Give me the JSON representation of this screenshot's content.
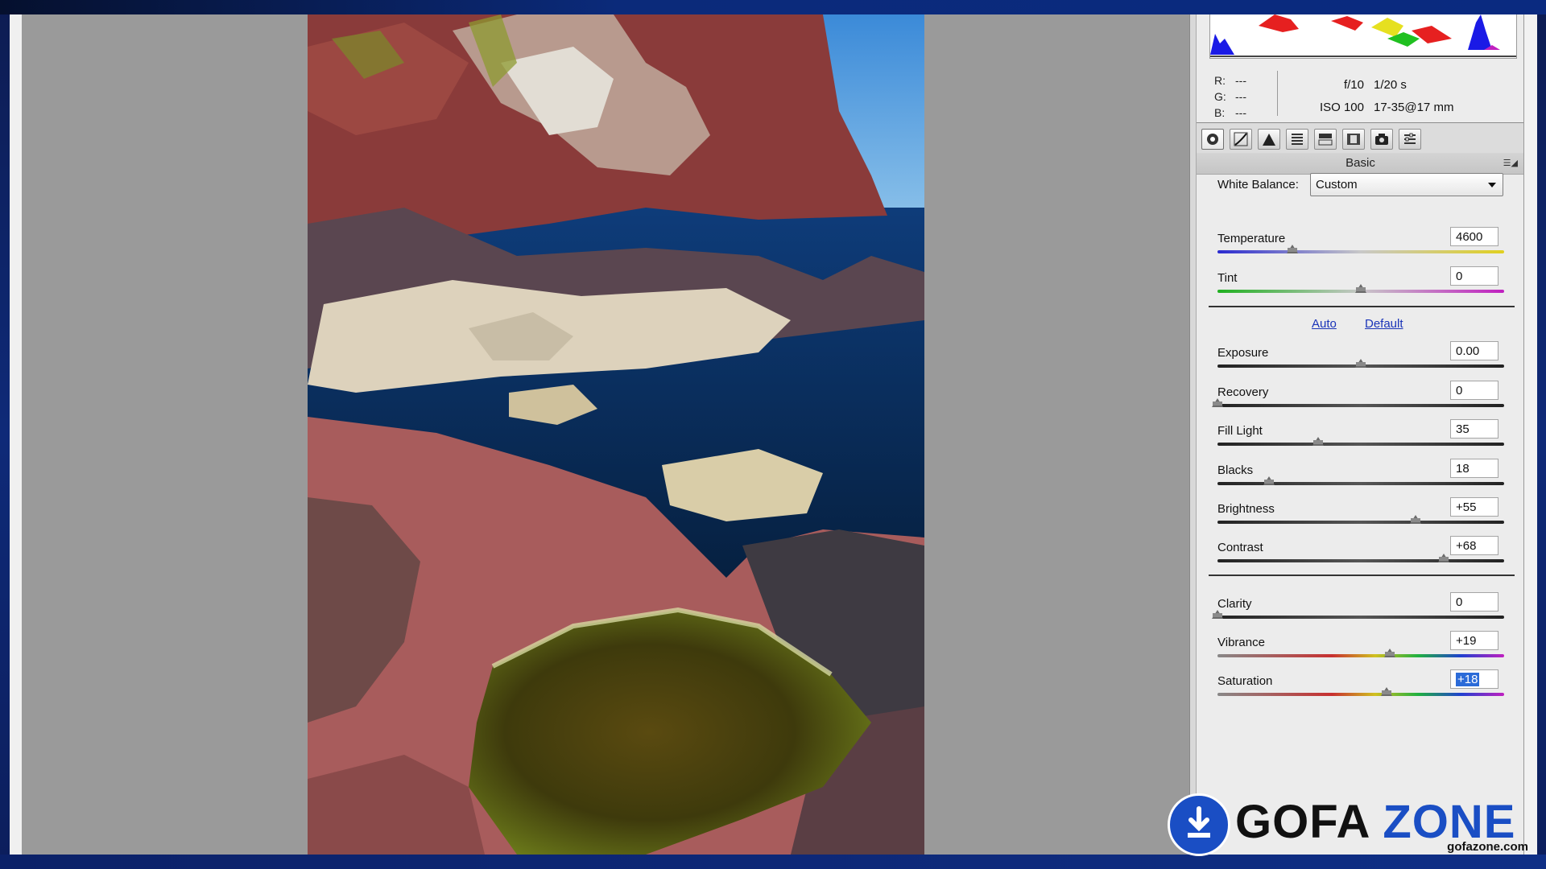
{
  "histogram": {
    "label": ""
  },
  "info": {
    "r_label": "R:",
    "r_value": "---",
    "g_label": "G:",
    "g_value": "---",
    "b_label": "B:",
    "b_value": "---",
    "aperture": "f/10",
    "shutter": "1/20 s",
    "iso": "ISO 100",
    "lens": "17-35@17 mm"
  },
  "toolbar": {
    "tools": [
      "basic-icon",
      "tone-curve-icon",
      "detail-icon",
      "hsl-icon",
      "split-toning-icon",
      "lens-corrections-icon",
      "camera-calibration-icon",
      "presets-icon"
    ],
    "active_index": 0
  },
  "panel": {
    "section_title": "Basic",
    "white_balance_label": "White Balance:",
    "white_balance_value": "Custom",
    "auto_label": "Auto",
    "default_label": "Default"
  },
  "sliders": [
    {
      "key": "temperature",
      "label": "Temperature",
      "value": "4600",
      "position": 0.26
    },
    {
      "key": "tint",
      "label": "Tint",
      "value": "0",
      "position": 0.5
    },
    {
      "key": "exposure",
      "label": "Exposure",
      "value": "0.00",
      "position": 0.5
    },
    {
      "key": "recovery",
      "label": "Recovery",
      "value": "0",
      "position": 0.0
    },
    {
      "key": "fill-light",
      "label": "Fill Light",
      "value": "35",
      "position": 0.35
    },
    {
      "key": "blacks",
      "label": "Blacks",
      "value": "18",
      "position": 0.18
    },
    {
      "key": "brightness",
      "label": "Brightness",
      "value": "+55",
      "position": 0.69
    },
    {
      "key": "contrast",
      "label": "Contrast",
      "value": "+68",
      "position": 0.79
    },
    {
      "key": "clarity",
      "label": "Clarity",
      "value": "0",
      "position": 0.0
    },
    {
      "key": "vibrance",
      "label": "Vibrance",
      "value": "+19",
      "position": 0.6
    },
    {
      "key": "saturation",
      "label": "Saturation",
      "value": "+18",
      "position": 0.59,
      "selected": true
    }
  ],
  "watermark": {
    "text_a": "GOFA ",
    "text_b": "ZONE",
    "url": "gofazone.com"
  },
  "colors": {
    "accent": "#1a4ec4",
    "link": "#1a34b8"
  }
}
